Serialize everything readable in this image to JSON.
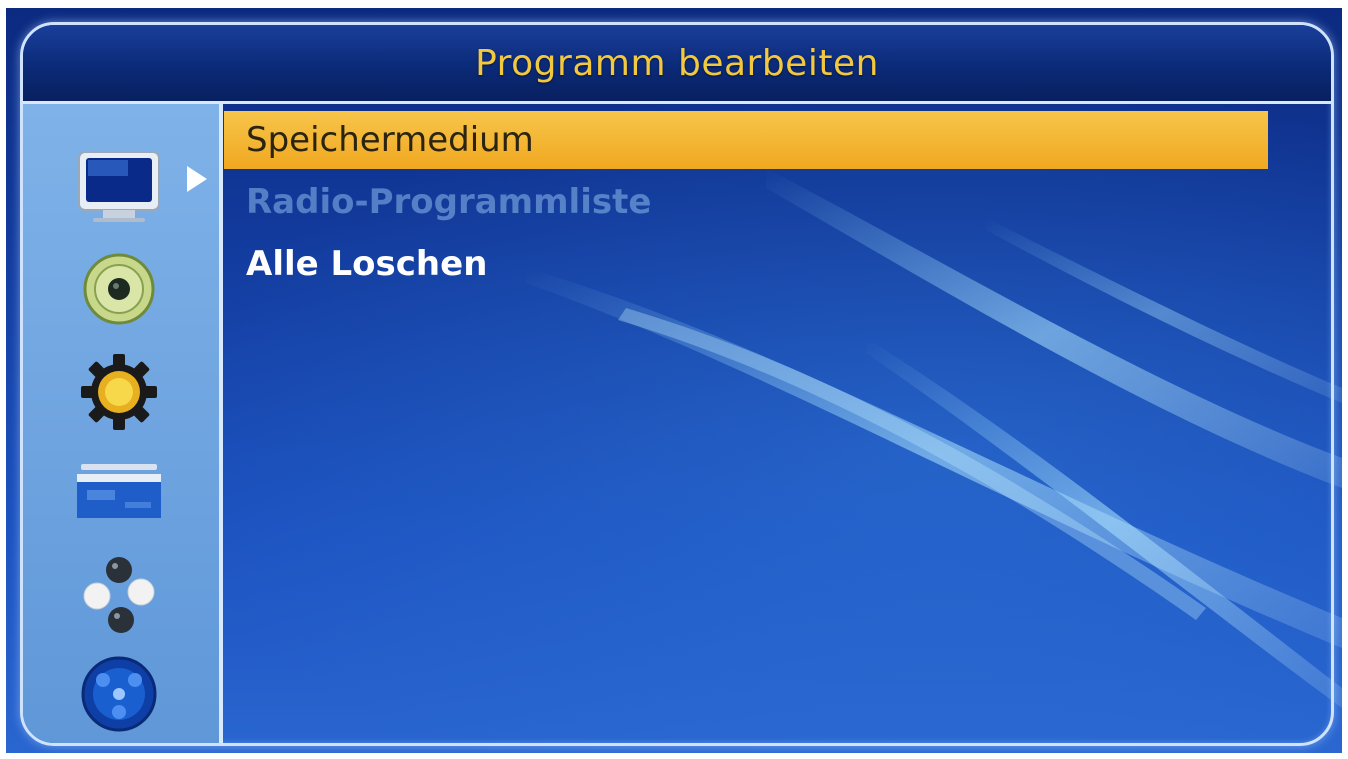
{
  "title": "Programm bearbeiten",
  "menu": {
    "items": [
      {
        "label": "Speichermedium",
        "state": "selected"
      },
      {
        "label": "Radio-Programmliste",
        "state": "disabled"
      },
      {
        "label": "Alle Loschen",
        "state": "normal"
      }
    ]
  },
  "sidebar": {
    "icons": [
      "tv-icon",
      "speaker-icon",
      "settings-gear-icon",
      "media-player-icon",
      "games-icon",
      "disc-icon"
    ],
    "selected_index": 0
  },
  "colors": {
    "title": "#f2c840",
    "selection": "#f0a820",
    "background": "#123a9c",
    "sidebar": "#6fa4e0"
  }
}
